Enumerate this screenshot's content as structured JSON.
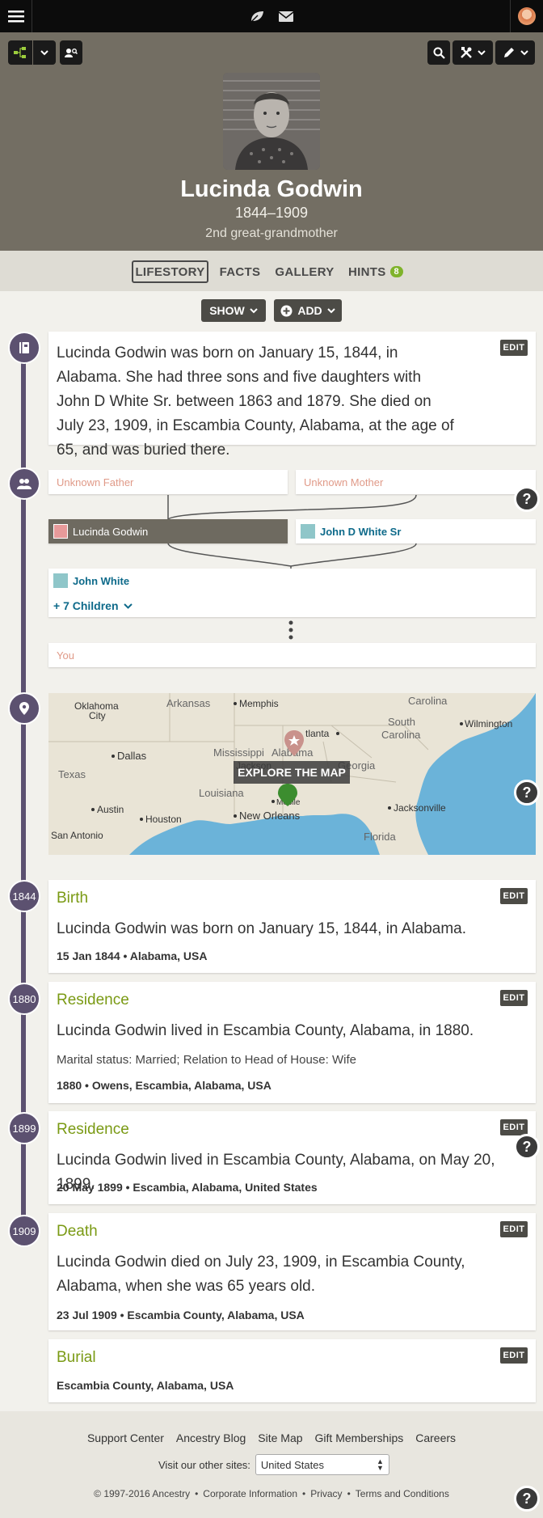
{
  "topbar": {
    "menu_icon": "hamburger-menu-icon",
    "leaf_icon": "leaf-hint-icon",
    "mail_icon": "mail-icon"
  },
  "hero": {
    "name": "Lucinda Godwin",
    "dates": "1844–1909",
    "relationship": "2nd great-grandmother"
  },
  "tabs": [
    {
      "label": "LIFESTORY",
      "active": true
    },
    {
      "label": "FACTS"
    },
    {
      "label": "GALLERY"
    },
    {
      "label": "HINTS",
      "badge": "8"
    }
  ],
  "actions": {
    "show_label": "SHOW",
    "add_label": "ADD"
  },
  "story": {
    "text": "Lucinda Godwin was born on January 15, 1844, in Alabama. She had three sons and five daughters with John D White Sr. between 1863 and 1879. She died on July 23, 1909, in Escambia County, Alabama, at the age of 65, and was buried there.",
    "edit": "EDIT"
  },
  "family": {
    "father": "Unknown Father",
    "mother": "Unknown Mother",
    "self": "Lucinda Godwin",
    "spouse": "John D White Sr",
    "child": "John White",
    "more_children": "+ 7 Children",
    "you": "You"
  },
  "map": {
    "button": "EXPLORE THE MAP",
    "labels": [
      "Oklahoma City",
      "Arkansas",
      "Memphis",
      "Carolina",
      "Atlanta",
      "South Carolina",
      "Wilmington",
      "Dallas",
      "Mississippi",
      "Alabama",
      "Jackson",
      "Georgia",
      "Texas",
      "Louisiana",
      "Mobile",
      "Austin",
      "Houston",
      "New Orleans",
      "Jacksonville",
      "San Antonio",
      "Florida"
    ]
  },
  "events": [
    {
      "year": "1844",
      "title": "Birth",
      "desc": "Lucinda Godwin was born on January 15, 1844, in Alabama.",
      "meta": "15 Jan 1844 • Alabama, USA",
      "edit": "EDIT"
    },
    {
      "year": "1880",
      "title": "Residence",
      "desc": "Lucinda Godwin lived in Escambia County, Alabama, in 1880.",
      "sub": "Marital status: Married; Relation to Head of House: Wife",
      "meta": "1880 • Owens, Escambia, Alabama, USA",
      "edit": "EDIT"
    },
    {
      "year": "1899",
      "title": "Residence",
      "desc": "Lucinda Godwin lived in Escambia County, Alabama, on May 20, 1899.",
      "meta": "20 May 1899 • Escambia, Alabama, United States",
      "edit": "EDIT"
    },
    {
      "year": "1909",
      "title": "Death",
      "desc": "Lucinda Godwin died on July 23, 1909, in Escambia County, Alabama, when she was 65 years old.",
      "meta": "23 Jul 1909 • Escambia County, Alabama, USA",
      "edit": "EDIT"
    },
    {
      "title": "Burial",
      "meta": "Escambia County, Alabama, USA",
      "edit": "EDIT"
    }
  ],
  "footer": {
    "links": [
      "Support Center",
      "Ancestry Blog",
      "Site Map",
      "Gift Memberships",
      "Careers"
    ],
    "other_sites_label": "Visit our other sites:",
    "other_sites_value": "United States",
    "legal": [
      "© 1997-2016 Ancestry",
      "Corporate Information",
      "Privacy",
      "Terms and Conditions"
    ]
  },
  "colors": {
    "accent_green": "#7a9a14",
    "timeline_purple": "#5c5170",
    "hero_bg": "#736e63",
    "link_teal": "#0e6a8a"
  }
}
